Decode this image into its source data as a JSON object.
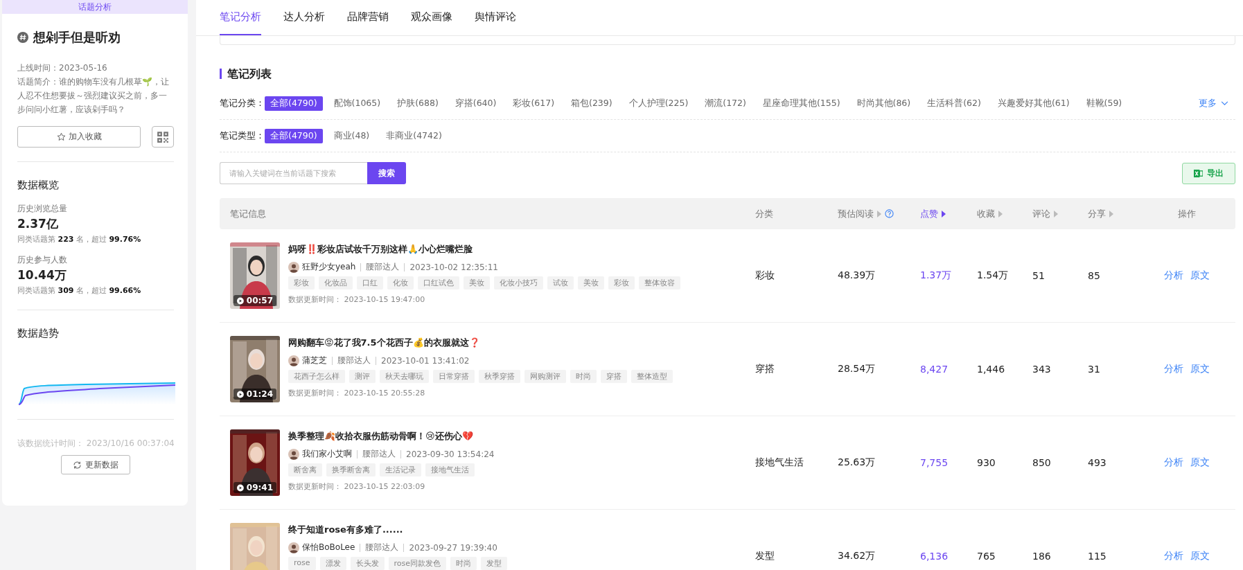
{
  "sidebar": {
    "header": "话题分析",
    "topic": "想剁手但是听劝",
    "online_label": "上线时间：",
    "online_date": "2023-05-16",
    "intro_label": "话题简介：",
    "intro": "谁的购物车没有几根草🌱，让人忍不住想要拔～强烈建议买之前，多一步问问小红薯，应该剁手吗？",
    "favorite_button": "加入收藏",
    "overview_title": "数据概览",
    "stats": [
      {
        "label": "历史浏览总量",
        "value": "2.37亿",
        "rank": "同类话题第 **223** 名，超过 **99.76%**"
      },
      {
        "label": "历史参与人数",
        "value": "10.44万",
        "rank": "同类话题第 **309** 名，超过 **99.66%**"
      }
    ],
    "trend_title": "数据趋势",
    "stat_time_label": "该数据统计时间：",
    "stat_time": "2023/10/16 00:37:04",
    "refresh_button": "更新数据"
  },
  "tabs": [
    {
      "label": "笔记分析",
      "selected": true
    },
    {
      "label": "达人分析",
      "selected": false
    },
    {
      "label": "品牌营销",
      "selected": false
    },
    {
      "label": "观众画像",
      "selected": false
    },
    {
      "label": "舆情评论",
      "selected": false
    }
  ],
  "section_title": "笔记列表",
  "filters": [
    {
      "label": "笔记分类：",
      "more": "更多",
      "options": [
        {
          "label": "全部(4790)",
          "selected": true
        },
        {
          "label": "配饰(1065)",
          "selected": false
        },
        {
          "label": "护肤(688)",
          "selected": false
        },
        {
          "label": "穿搭(640)",
          "selected": false
        },
        {
          "label": "彩妆(617)",
          "selected": false
        },
        {
          "label": "箱包(239)",
          "selected": false
        },
        {
          "label": "个人护理(225)",
          "selected": false
        },
        {
          "label": "潮流(172)",
          "selected": false
        },
        {
          "label": "星座命理其他(155)",
          "selected": false
        },
        {
          "label": "时尚其他(86)",
          "selected": false
        },
        {
          "label": "生活科普(62)",
          "selected": false
        },
        {
          "label": "兴趣爱好其他(61)",
          "selected": false
        },
        {
          "label": "鞋靴(59)",
          "selected": false
        }
      ]
    },
    {
      "label": "笔记类型：",
      "options": [
        {
          "label": "全部(4790)",
          "selected": true
        },
        {
          "label": "商业(48)",
          "selected": false
        },
        {
          "label": "非商业(4742)",
          "selected": false
        }
      ]
    }
  ],
  "search": {
    "placeholder": "请输入关键词在当前话题下搜索",
    "button": "搜索"
  },
  "export_button": "导出",
  "table": {
    "columns": [
      {
        "label": "笔记信息",
        "kind": "plain",
        "selected": false
      },
      {
        "label": "分类",
        "kind": "plain",
        "selected": false
      },
      {
        "label": "预估阅读",
        "kind": "sort_help",
        "selected": false
      },
      {
        "label": "点赞",
        "kind": "sort",
        "selected": true
      },
      {
        "label": "收藏",
        "kind": "sort",
        "selected": false
      },
      {
        "label": "评论",
        "kind": "sort",
        "selected": false
      },
      {
        "label": "分享",
        "kind": "sort",
        "selected": false
      },
      {
        "label": "操作",
        "kind": "plain",
        "selected": false
      }
    ],
    "rows": [
      {
        "duration": "00:57",
        "title": "妈呀‼️彩妆店试妆千万别这样🙏小心烂嘴烂脸",
        "author": "狂野少女yeah",
        "level": "腰部达人",
        "date": "2023-10-02 12:35:11",
        "tags": [
          "彩妆",
          "化妆品",
          "口红",
          "化妆",
          "口红试色",
          "美妆",
          "化妆小技巧",
          "试妆",
          "美妆",
          "彩妆",
          "整体妆容"
        ],
        "update_label": "数据更新时间：",
        "update_time": "2023-10-15 19:47:00",
        "category": "彩妆",
        "reads": "48.39万",
        "likes": "1.37万",
        "collects": "1.54万",
        "comments": "51",
        "shares": "85",
        "actions": [
          "分析",
          "原文"
        ]
      },
      {
        "duration": "01:24",
        "title": "网购翻车😡花了我7.5个花西子💰的衣服就这❓",
        "author": "蒲芝芝",
        "level": "腰部达人",
        "date": "2023-10-01 13:41:02",
        "tags": [
          "花西子怎么样",
          "测评",
          "秋天去哪玩",
          "日常穿搭",
          "秋季穿搭",
          "网购测评",
          "时尚",
          "穿搭",
          "整体造型"
        ],
        "update_label": "数据更新时间：",
        "update_time": "2023-10-15 20:55:28",
        "category": "穿搭",
        "reads": "28.54万",
        "likes": "8,427",
        "collects": "1,446",
        "comments": "343",
        "shares": "31",
        "actions": [
          "分析",
          "原文"
        ]
      },
      {
        "duration": "09:41",
        "title": "换季整理🍂收拾衣服伤筋动骨啊！😢还伤心💔",
        "author": "我们家小艾啊",
        "level": "腰部达人",
        "date": "2023-09-30 13:54:24",
        "tags": [
          "断舍离",
          "换季断舍离",
          "生活记录",
          "接地气生活"
        ],
        "update_label": "数据更新时间：",
        "update_time": "2023-10-15 22:03:09",
        "category": "接地气生活",
        "reads": "25.63万",
        "likes": "7,755",
        "collects": "930",
        "comments": "850",
        "shares": "493",
        "actions": [
          "分析",
          "原文"
        ]
      },
      {
        "title": "终于知道rose有多难了......",
        "author": "保怡BoBoLee",
        "level": "腰部达人",
        "date": "2023-09-27 19:39:40",
        "tags": [
          "rose",
          "漂发",
          "长头发",
          "rose同款发色",
          "时尚",
          "发型"
        ],
        "category": "发型",
        "reads": "34.62万",
        "likes": "6,136",
        "collects": "765",
        "comments": "186",
        "shares": "115",
        "actions": [
          "分析",
          "原文"
        ]
      }
    ]
  }
}
